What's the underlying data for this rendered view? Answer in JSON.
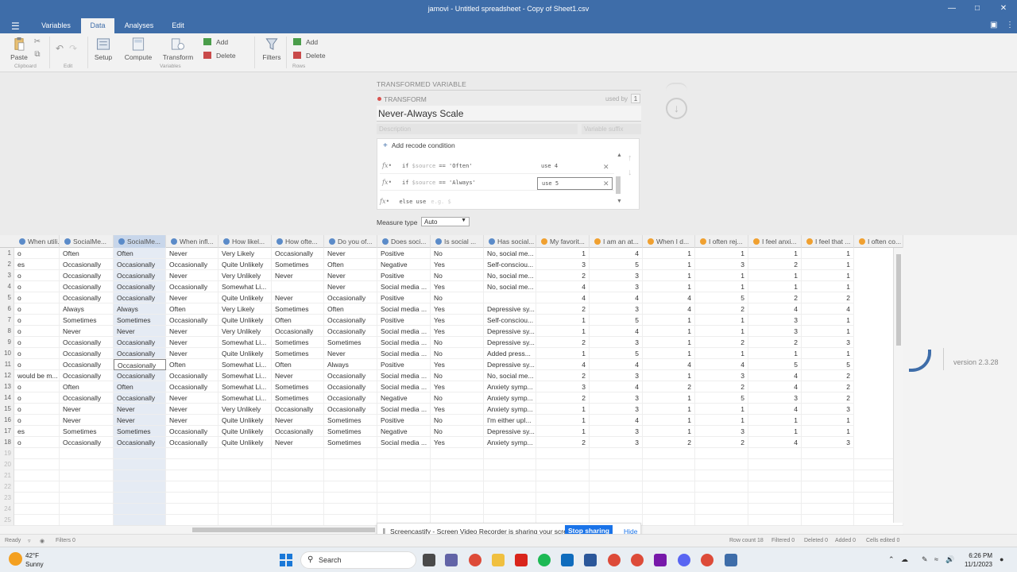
{
  "window": {
    "title": "jamovi - Untitled spreadsheet - Copy of Sheet1.csv"
  },
  "menu": {
    "tabs": [
      "Variables",
      "Data",
      "Analyses",
      "Edit"
    ],
    "active": "Data"
  },
  "ribbon": {
    "paste": "Paste",
    "clipboard": "Clipboard",
    "edit": "Edit",
    "setup": "Setup",
    "compute": "Compute",
    "transform": "Transform",
    "var_add": "Add",
    "var_delete": "Delete",
    "variables": "Variables",
    "filters": "Filters",
    "row_add": "Add",
    "row_delete": "Delete",
    "rows": "Rows"
  },
  "transform": {
    "section_title": "TRANSFORMED VARIABLE",
    "label": "TRANSFORM",
    "used_by_label": "used by",
    "used_by_count": "1",
    "name": "Never-Always Scale",
    "description_placeholder": "Description",
    "suffix_placeholder": "Variable suffix",
    "add_condition": "Add recode condition",
    "conditions": [
      {
        "if_kw": "if",
        "var": "$source",
        "op": "==",
        "value": "'Often'",
        "use": "use 4"
      },
      {
        "if_kw": "if",
        "var": "$source",
        "op": "==",
        "value": "'Always'",
        "use": "use 5"
      }
    ],
    "else_use": "else use",
    "else_placeholder": "e.g. $",
    "measure_type_label": "Measure type",
    "measure_type_value": "Auto"
  },
  "grid": {
    "columns": [
      "When utili...",
      "SocialMe...",
      "SocialMe...",
      "When infl...",
      "How likel...",
      "How ofte...",
      "Do you of...",
      "Does soci...",
      "Is social ...",
      "Has social...",
      "My favorit...",
      "I am an at...",
      "When I d...",
      "I often rej...",
      "I feel anxi...",
      "I feel that ...",
      "I often co..."
    ],
    "rows": [
      [
        "1",
        "o",
        "Often",
        "Often",
        "Never",
        "Very Likely",
        "Occasionally",
        "Never",
        "Positive",
        "No",
        "No, social me...",
        "1",
        "4",
        "1",
        "1",
        "1",
        "1"
      ],
      [
        "2",
        "es",
        "Occasionally",
        "Occasionally",
        "Occasionally",
        "Quite Unlikely",
        "Sometimes",
        "Often",
        "Negative",
        "Yes",
        "Self-consciou...",
        "3",
        "5",
        "1",
        "3",
        "2",
        "1"
      ],
      [
        "3",
        "o",
        "Occasionally",
        "Occasionally",
        "Never",
        "Very Unlikely",
        "Never",
        "Never",
        "Positive",
        "No",
        "No, social me...",
        "2",
        "3",
        "1",
        "1",
        "1",
        "1"
      ],
      [
        "4",
        "o",
        "Occasionally",
        "Occasionally",
        "Occasionally",
        "Somewhat Li...",
        "",
        "Never",
        "Social media ...",
        "Yes",
        "No, social me...",
        "4",
        "3",
        "1",
        "1",
        "1",
        "1"
      ],
      [
        "5",
        "o",
        "Occasionally",
        "Occasionally",
        "Never",
        "Quite Unlikely",
        "Never",
        "Occasionally",
        "Positive",
        "No",
        "",
        "4",
        "4",
        "4",
        "5",
        "2",
        "2"
      ],
      [
        "6",
        "o",
        "Always",
        "Always",
        "Often",
        "Very Likely",
        "Sometimes",
        "Often",
        "Social media ...",
        "Yes",
        "Depressive sy...",
        "2",
        "3",
        "4",
        "2",
        "4",
        "4"
      ],
      [
        "7",
        "o",
        "Sometimes",
        "Sometimes",
        "Occasionally",
        "Quite Unlikely",
        "Often",
        "Occasionally",
        "Positive",
        "Yes",
        "Self-consciou...",
        "1",
        "5",
        "1",
        "1",
        "3",
        "1"
      ],
      [
        "8",
        "o",
        "Never",
        "Never",
        "Never",
        "Very Unlikely",
        "Occasionally",
        "Occasionally",
        "Social media ...",
        "Yes",
        "Depressive sy...",
        "1",
        "4",
        "1",
        "1",
        "3",
        "1"
      ],
      [
        "9",
        "o",
        "Occasionally",
        "Occasionally",
        "Never",
        "Somewhat Li...",
        "Sometimes",
        "Sometimes",
        "Social media ...",
        "No",
        "Depressive sy...",
        "2",
        "3",
        "1",
        "2",
        "2",
        "3"
      ],
      [
        "10",
        "o",
        "Occasionally",
        "Occasionally",
        "Never",
        "Quite Unlikely",
        "Sometimes",
        "Never",
        "Social media ...",
        "No",
        "Added press...",
        "1",
        "5",
        "1",
        "1",
        "1",
        "1"
      ],
      [
        "11",
        "o",
        "Occasionally",
        "Occasionally",
        "Often",
        "Somewhat Li...",
        "Often",
        "Always",
        "Positive",
        "Yes",
        "Depressive sy...",
        "4",
        "4",
        "4",
        "4",
        "5",
        "5"
      ],
      [
        "12",
        "would be m...",
        "Occasionally",
        "Occasionally",
        "Occasionally",
        "Somewhat Li...",
        "Never",
        "Occasionally",
        "Social media ...",
        "No",
        "No, social me...",
        "2",
        "3",
        "1",
        "3",
        "4",
        "2"
      ],
      [
        "13",
        "o",
        "Often",
        "Often",
        "Occasionally",
        "Somewhat Li...",
        "Sometimes",
        "Occasionally",
        "Social media ...",
        "Yes",
        "Anxiety symp...",
        "3",
        "4",
        "2",
        "2",
        "4",
        "2"
      ],
      [
        "14",
        "o",
        "Occasionally",
        "Occasionally",
        "Never",
        "Somewhat Li...",
        "Sometimes",
        "Occasionally",
        "Negative",
        "No",
        "Anxiety symp...",
        "2",
        "3",
        "1",
        "5",
        "3",
        "2"
      ],
      [
        "15",
        "o",
        "Never",
        "Never",
        "Never",
        "Very Unlikely",
        "Occasionally",
        "Occasionally",
        "Social media ...",
        "Yes",
        "Anxiety symp...",
        "1",
        "3",
        "1",
        "1",
        "4",
        "3"
      ],
      [
        "16",
        "o",
        "Never",
        "Never",
        "Never",
        "Quite Unlikely",
        "Never",
        "Sometimes",
        "Positive",
        "No",
        "I'm either upl...",
        "1",
        "4",
        "1",
        "1",
        "1",
        "1"
      ],
      [
        "17",
        "es",
        "Sometimes",
        "Sometimes",
        "Occasionally",
        "Quite Unlikely",
        "Occasionally",
        "Sometimes",
        "Negative",
        "No",
        "Depressive sy...",
        "1",
        "3",
        "1",
        "3",
        "1",
        "1"
      ],
      [
        "18",
        "o",
        "Occasionally",
        "Occasionally",
        "Occasionally",
        "Quite Unlikely",
        "Never",
        "Sometimes",
        "Social media ...",
        "Yes",
        "Anxiety symp...",
        "2",
        "3",
        "2",
        "2",
        "4",
        "3"
      ]
    ],
    "empty_row_numbers": [
      "19",
      "20",
      "21",
      "22",
      "23",
      "24",
      "25"
    ]
  },
  "version": "version 2.3.28",
  "share_banner": {
    "text": "Screencastify - Screen Video Recorder is sharing your screen.",
    "stop": "Stop sharing",
    "hide": "Hide"
  },
  "status": {
    "ready": "Ready",
    "filters": "Filters 0",
    "row_count": "Row count 18",
    "filtered": "Filtered 0",
    "deleted": "Deleted 0",
    "added": "Added 0",
    "cells_edited": "Cells edited 0"
  },
  "taskbar": {
    "temp": "42°F",
    "weather": "Sunny",
    "search": "Search",
    "time": "6:26 PM",
    "date": "11/1/2023"
  },
  "colors": {
    "accent": "#3e6da9",
    "selected_col": "#e5ebf4",
    "stop_button": "#1a73e8"
  }
}
